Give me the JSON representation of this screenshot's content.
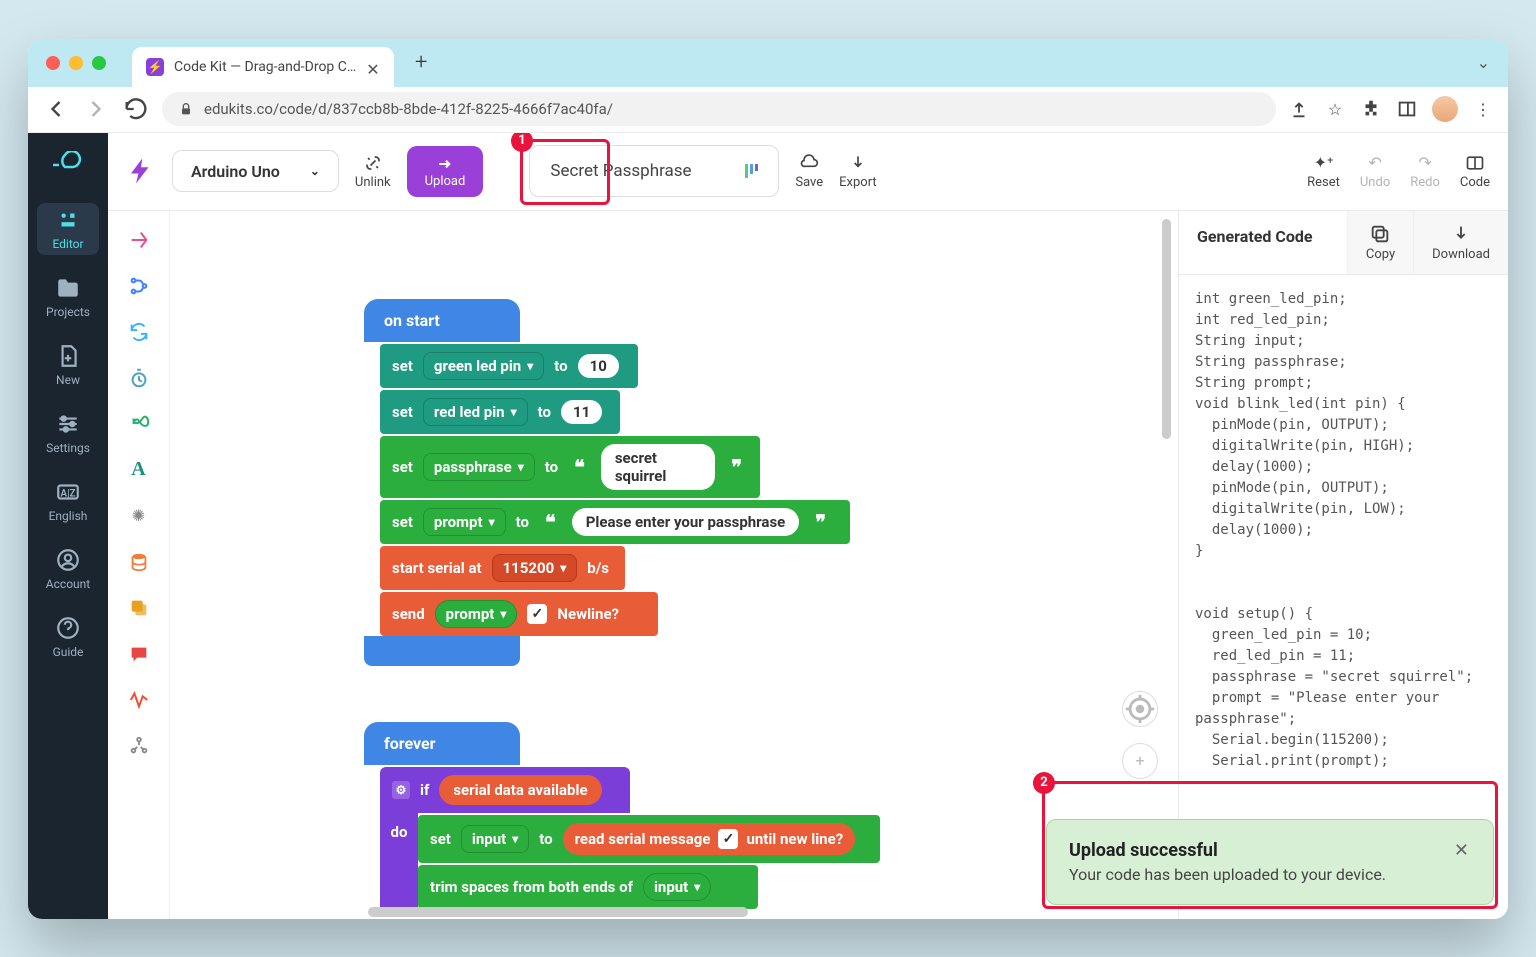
{
  "browser": {
    "tab_title": "Code Kit — Drag-and-Drop C…",
    "url": "edukits.co/code/d/837ccb8b-8bde-412f-8225-4666f7ac40fa/"
  },
  "leftrail": {
    "items": [
      "Editor",
      "Projects",
      "New",
      "Settings",
      "English",
      "Account",
      "Guide"
    ]
  },
  "topbar": {
    "board": "Arduino Uno",
    "unlink": "Unlink",
    "upload": "Upload",
    "project": "Secret Passphrase",
    "save": "Save",
    "export": "Export",
    "reset": "Reset",
    "undo": "Undo",
    "redo": "Redo",
    "code": "Code"
  },
  "blocks": {
    "onstart": {
      "hat": "on start",
      "rows": [
        {
          "set": "set",
          "var": "green led pin",
          "to": "to",
          "val": "10"
        },
        {
          "set": "set",
          "var": "red led pin",
          "to": "to",
          "val": "11"
        },
        {
          "set": "set",
          "var": "passphrase",
          "to": "to",
          "val": "secret squirrel"
        },
        {
          "set": "set",
          "var": "prompt",
          "to": "to",
          "val": "Please enter your passphrase"
        }
      ],
      "serial": {
        "label": "start serial at",
        "baud": "115200",
        "unit": "b/s"
      },
      "send": {
        "label": "send",
        "var": "prompt",
        "newline": "Newline?"
      }
    },
    "forever": {
      "hat": "forever",
      "if_label": "if",
      "cond": "serial data available",
      "do": "do",
      "setrow": {
        "set": "set",
        "var": "input",
        "to": "to",
        "action": "read serial message",
        "until": "until new line?"
      },
      "trim": {
        "label": "trim spaces from both ends of",
        "arg": "input"
      }
    }
  },
  "codepane": {
    "title": "Generated Code",
    "copy": "Copy",
    "download": "Download",
    "code": "int green_led_pin;\nint red_led_pin;\nString input;\nString passphrase;\nString prompt;\nvoid blink_led(int pin) {\n  pinMode(pin, OUTPUT);\n  digitalWrite(pin, HIGH);\n  delay(1000);\n  pinMode(pin, OUTPUT);\n  digitalWrite(pin, LOW);\n  delay(1000);\n}\n\n\nvoid setup() {\n  green_led_pin = 10;\n  red_led_pin = 11;\n  passphrase = \"secret squirrel\";\n  prompt = \"Please enter your\npassphrase\";\n  Serial.begin(115200);\n  Serial.print(prompt);\n\n\n\n\n  Serial.readStringUntil('\\n');\n    String(input).trim();"
  },
  "toast": {
    "title": "Upload successful",
    "message": "Your code has been uploaded to your device."
  },
  "callouts": {
    "c1": "1",
    "c2": "2"
  }
}
